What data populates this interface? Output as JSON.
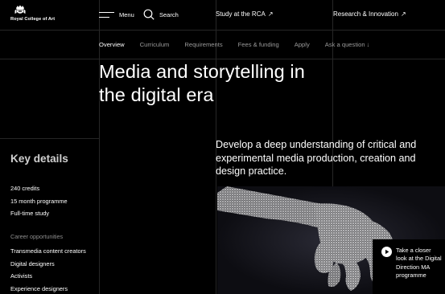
{
  "brand": {
    "name": "Royal College of Art"
  },
  "header": {
    "menu_label": "Menu",
    "search_label": "Search",
    "links": [
      {
        "label": "Study at the RCA",
        "arrow": "↗"
      },
      {
        "label": "Research & Innovation",
        "arrow": "↗"
      }
    ]
  },
  "subnav": {
    "tabs": [
      {
        "label": "Overview",
        "active": true
      },
      {
        "label": "Curriculum",
        "active": false
      },
      {
        "label": "Requirements",
        "active": false
      },
      {
        "label": "Fees & funding",
        "active": false
      },
      {
        "label": "Apply",
        "active": false
      },
      {
        "label": "Ask a question ↓",
        "active": false
      }
    ]
  },
  "hero": {
    "title_line1": "Media and storytelling in",
    "title_line2": "the digital era"
  },
  "key_details": {
    "title": "Key details",
    "items": [
      "240 credits",
      "15 month programme",
      "Full-time study"
    ],
    "career_title": "Career opportunities",
    "careers": [
      "Transmedia content creators",
      "Digital designers",
      "Activists",
      "Experience designers"
    ]
  },
  "lead": {
    "text": "Develop a deep understanding of critical and experimental media production, creation and design practice."
  },
  "video_card": {
    "text": "Take a closer look at the Digital Direction MA programme"
  },
  "colors": {
    "background": "#000000",
    "text": "#ffffff",
    "muted": "#9a9a9a",
    "divider": "#262626"
  }
}
